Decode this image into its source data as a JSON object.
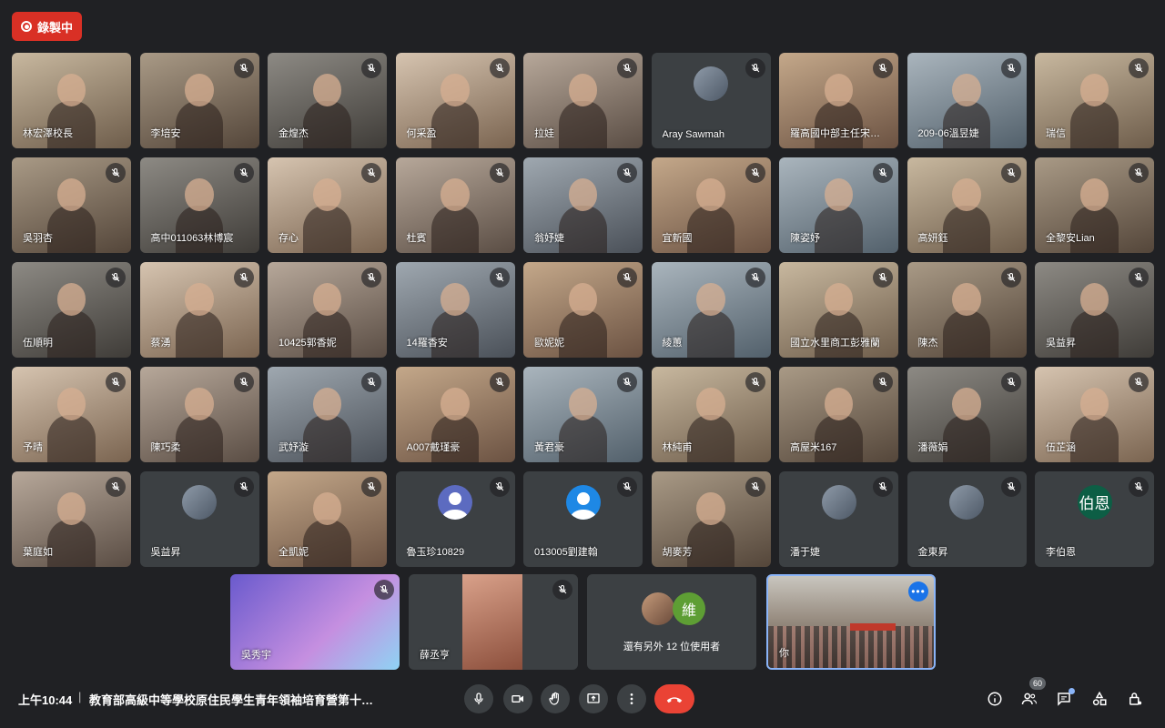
{
  "recording_label": "錄製中",
  "tiles": [
    {
      "name": "林宏澤校長",
      "muted": false,
      "type": "cam"
    },
    {
      "name": "李培安",
      "muted": true,
      "type": "cam"
    },
    {
      "name": "金煌杰",
      "muted": true,
      "type": "cam"
    },
    {
      "name": "何采盈",
      "muted": true,
      "type": "cam"
    },
    {
      "name": "拉娃",
      "muted": true,
      "type": "cam"
    },
    {
      "name": "Aray Sawmah",
      "muted": true,
      "type": "avatar"
    },
    {
      "name": "羅高國中部主任宋…",
      "muted": true,
      "type": "cam"
    },
    {
      "name": "209-06溫昱婕",
      "muted": true,
      "type": "cam"
    },
    {
      "name": "瑞信",
      "muted": true,
      "type": "cam"
    },
    {
      "name": "吳羽杏",
      "muted": true,
      "type": "cam"
    },
    {
      "name": "高中011063林博宸",
      "muted": true,
      "type": "cam"
    },
    {
      "name": "存心",
      "muted": true,
      "type": "cam"
    },
    {
      "name": "杜賓",
      "muted": true,
      "type": "cam"
    },
    {
      "name": "翁妤婕",
      "muted": true,
      "type": "cam"
    },
    {
      "name": "宜新國",
      "muted": true,
      "type": "cam"
    },
    {
      "name": "陳姿妤",
      "muted": true,
      "type": "cam"
    },
    {
      "name": "高妍鈺",
      "muted": true,
      "type": "cam"
    },
    {
      "name": "全黎安Lian",
      "muted": true,
      "type": "cam"
    },
    {
      "name": "伍順明",
      "muted": true,
      "type": "cam"
    },
    {
      "name": "蔡湧",
      "muted": true,
      "type": "cam"
    },
    {
      "name": "10425郭香妮",
      "muted": true,
      "type": "cam"
    },
    {
      "name": "14羅香安",
      "muted": true,
      "type": "cam"
    },
    {
      "name": "歐妮妮",
      "muted": true,
      "type": "cam"
    },
    {
      "name": "綾蕙",
      "muted": true,
      "type": "cam"
    },
    {
      "name": "國立水里商工彭雅蘭",
      "muted": true,
      "type": "cam"
    },
    {
      "name": "陳杰",
      "muted": true,
      "type": "cam"
    },
    {
      "name": "吳益昇",
      "muted": true,
      "type": "cam"
    },
    {
      "name": "予晴",
      "muted": true,
      "type": "cam"
    },
    {
      "name": "陳巧柔",
      "muted": true,
      "type": "cam"
    },
    {
      "name": "武妤漩",
      "muted": true,
      "type": "cam"
    },
    {
      "name": "A007戴瑾豪",
      "muted": true,
      "type": "cam"
    },
    {
      "name": "黃君豪",
      "muted": true,
      "type": "cam"
    },
    {
      "name": "林純甫",
      "muted": true,
      "type": "cam"
    },
    {
      "name": "高屋米167",
      "muted": true,
      "type": "cam"
    },
    {
      "name": "潘薇娟",
      "muted": true,
      "type": "cam"
    },
    {
      "name": "伍芷涵",
      "muted": true,
      "type": "cam"
    },
    {
      "name": "葉庭如",
      "muted": true,
      "type": "cam"
    },
    {
      "name": "吳益昇",
      "muted": true,
      "type": "avatar"
    },
    {
      "name": "全凱妮",
      "muted": true,
      "type": "cam"
    },
    {
      "name": "魯玉珍10829",
      "muted": true,
      "type": "default-blue"
    },
    {
      "name": "013005劉建翰",
      "muted": true,
      "type": "default-lblue"
    },
    {
      "name": "胡麥芳",
      "muted": true,
      "type": "cam"
    },
    {
      "name": "潘于婕",
      "muted": true,
      "type": "avatar"
    },
    {
      "name": "金東昇",
      "muted": true,
      "type": "avatar"
    },
    {
      "name": "李伯恩",
      "muted": true,
      "type": "letter",
      "letter": "伯恩"
    }
  ],
  "bottom_tiles": [
    {
      "name": "吳秀宇",
      "muted": true
    },
    {
      "name": "薛丞亨",
      "muted": true
    }
  ],
  "others": {
    "label": "還有另外 12 位使用者",
    "avatar_letter": "維"
  },
  "self": {
    "name": "你"
  },
  "footer": {
    "time": "上午10:44",
    "separator": "|",
    "meeting_title": "教育部高級中等學校原住民學生青年領袖培育營第十期…",
    "participant_count": "60"
  }
}
